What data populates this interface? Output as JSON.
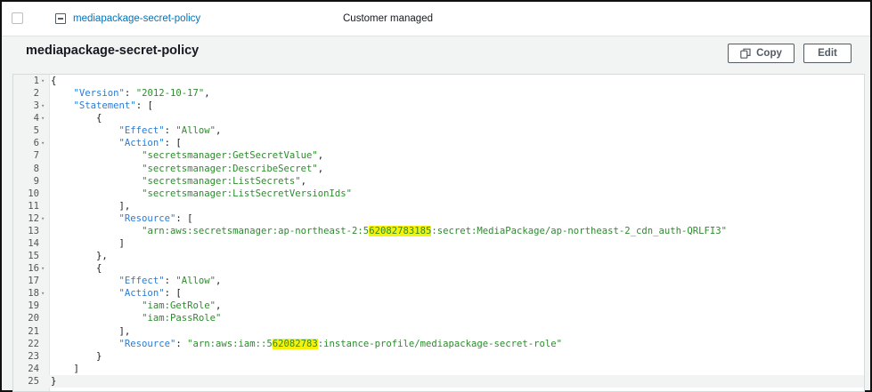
{
  "row": {
    "policy_name": "mediapackage-secret-policy",
    "policy_type": "Customer managed"
  },
  "panel": {
    "title": "mediapackage-secret-policy",
    "copy_label": "Copy",
    "edit_label": "Edit"
  },
  "editor": {
    "lines": [
      {
        "n": "1",
        "fold": true,
        "segs": [
          {
            "t": "{",
            "c": "p"
          }
        ]
      },
      {
        "n": "2",
        "fold": false,
        "segs": [
          {
            "t": "    ",
            "c": "p"
          },
          {
            "t": "\"Version\"",
            "c": "k"
          },
          {
            "t": ": ",
            "c": "p"
          },
          {
            "t": "\"2012-10-17\"",
            "c": "s"
          },
          {
            "t": ",",
            "c": "p"
          }
        ]
      },
      {
        "n": "3",
        "fold": true,
        "segs": [
          {
            "t": "    ",
            "c": "p"
          },
          {
            "t": "\"Statement\"",
            "c": "k"
          },
          {
            "t": ": [",
            "c": "p"
          }
        ]
      },
      {
        "n": "4",
        "fold": true,
        "segs": [
          {
            "t": "        {",
            "c": "p"
          }
        ]
      },
      {
        "n": "5",
        "fold": false,
        "segs": [
          {
            "t": "            ",
            "c": "p"
          },
          {
            "t": "\"Effect\"",
            "c": "k"
          },
          {
            "t": ": ",
            "c": "p"
          },
          {
            "t": "\"Allow\"",
            "c": "s"
          },
          {
            "t": ",",
            "c": "p"
          }
        ]
      },
      {
        "n": "6",
        "fold": true,
        "segs": [
          {
            "t": "            ",
            "c": "p"
          },
          {
            "t": "\"Action\"",
            "c": "k"
          },
          {
            "t": ": [",
            "c": "p"
          }
        ]
      },
      {
        "n": "7",
        "fold": false,
        "segs": [
          {
            "t": "                ",
            "c": "p"
          },
          {
            "t": "\"secretsmanager:GetSecretValue\"",
            "c": "s"
          },
          {
            "t": ",",
            "c": "p"
          }
        ]
      },
      {
        "n": "8",
        "fold": false,
        "segs": [
          {
            "t": "                ",
            "c": "p"
          },
          {
            "t": "\"secretsmanager:DescribeSecret\"",
            "c": "s"
          },
          {
            "t": ",",
            "c": "p"
          }
        ]
      },
      {
        "n": "9",
        "fold": false,
        "segs": [
          {
            "t": "                ",
            "c": "p"
          },
          {
            "t": "\"secretsmanager:ListSecrets\"",
            "c": "s"
          },
          {
            "t": ",",
            "c": "p"
          }
        ]
      },
      {
        "n": "10",
        "fold": false,
        "segs": [
          {
            "t": "                ",
            "c": "p"
          },
          {
            "t": "\"secretsmanager:ListSecretVersionIds\"",
            "c": "s"
          }
        ]
      },
      {
        "n": "11",
        "fold": false,
        "segs": [
          {
            "t": "            ],",
            "c": "p"
          }
        ]
      },
      {
        "n": "12",
        "fold": true,
        "segs": [
          {
            "t": "            ",
            "c": "p"
          },
          {
            "t": "\"Resource\"",
            "c": "k"
          },
          {
            "t": ": [",
            "c": "p"
          }
        ]
      },
      {
        "n": "13",
        "fold": false,
        "segs": [
          {
            "t": "                ",
            "c": "p"
          },
          {
            "t": "\"arn:aws:secretsmanager:ap-northeast-2:5",
            "c": "s"
          },
          {
            "t": "62082783185",
            "c": "s hl"
          },
          {
            "t": ":secret:MediaPackage/ap-northeast-2_cdn_auth-QRLFI3\"",
            "c": "s"
          }
        ]
      },
      {
        "n": "14",
        "fold": false,
        "segs": [
          {
            "t": "            ]",
            "c": "p"
          }
        ]
      },
      {
        "n": "15",
        "fold": false,
        "segs": [
          {
            "t": "        },",
            "c": "p"
          }
        ]
      },
      {
        "n": "16",
        "fold": true,
        "segs": [
          {
            "t": "        {",
            "c": "p"
          }
        ]
      },
      {
        "n": "17",
        "fold": false,
        "segs": [
          {
            "t": "            ",
            "c": "p"
          },
          {
            "t": "\"Effect\"",
            "c": "k"
          },
          {
            "t": ": ",
            "c": "p"
          },
          {
            "t": "\"Allow\"",
            "c": "s"
          },
          {
            "t": ",",
            "c": "p"
          }
        ]
      },
      {
        "n": "18",
        "fold": true,
        "segs": [
          {
            "t": "            ",
            "c": "p"
          },
          {
            "t": "\"Action\"",
            "c": "k"
          },
          {
            "t": ": [",
            "c": "p"
          }
        ]
      },
      {
        "n": "19",
        "fold": false,
        "segs": [
          {
            "t": "                ",
            "c": "p"
          },
          {
            "t": "\"iam:GetRole\"",
            "c": "s"
          },
          {
            "t": ",",
            "c": "p"
          }
        ]
      },
      {
        "n": "20",
        "fold": false,
        "segs": [
          {
            "t": "                ",
            "c": "p"
          },
          {
            "t": "\"iam:PassRole\"",
            "c": "s"
          }
        ]
      },
      {
        "n": "21",
        "fold": false,
        "segs": [
          {
            "t": "            ],",
            "c": "p"
          }
        ]
      },
      {
        "n": "22",
        "fold": false,
        "segs": [
          {
            "t": "            ",
            "c": "p"
          },
          {
            "t": "\"Resource\"",
            "c": "k"
          },
          {
            "t": ": ",
            "c": "p"
          },
          {
            "t": "\"arn:aws:iam::5",
            "c": "s"
          },
          {
            "t": "62082783",
            "c": "s hl"
          },
          {
            "t": ":instance-profile/mediapackage-secret-role\"",
            "c": "s"
          }
        ]
      },
      {
        "n": "23",
        "fold": false,
        "segs": [
          {
            "t": "        }",
            "c": "p"
          }
        ]
      },
      {
        "n": "24",
        "fold": false,
        "segs": [
          {
            "t": "    ]",
            "c": "p"
          }
        ]
      },
      {
        "n": "25",
        "fold": false,
        "active": true,
        "segs": [
          {
            "t": "}",
            "c": "p"
          }
        ]
      }
    ]
  },
  "colors": {
    "link": "#0073bb",
    "key": "#2a7bd6",
    "string": "#2e8b2e",
    "panel_bg": "#f2f3f3",
    "redaction_highlight": "#f5f20a"
  },
  "icons": {
    "row_expand": "minus-square-icon",
    "copy": "copy-icon",
    "fold": "fold-caret-icon"
  }
}
